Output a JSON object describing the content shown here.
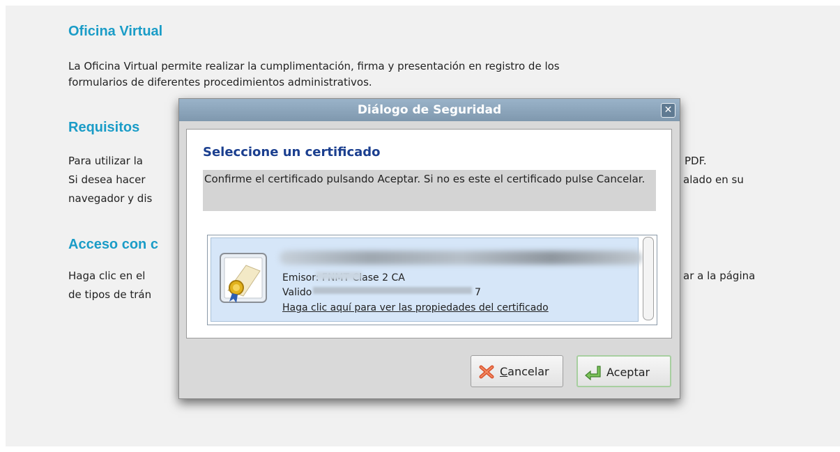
{
  "page": {
    "heading1": "Oficina Virtual",
    "para1_line1": "La Oficina Virtual permite realizar la cumplimentación, firma y presentación en registro de los",
    "para1_line2": "formularios de diferentes procedimientos administrativos.",
    "heading2": "Requisitos",
    "para2_line1_left": "Para utilizar la",
    "para2_line1_right": "PDF.",
    "para2_line2_left": "Si desea hacer",
    "para2_line2_right": "alado en su",
    "para2_line3_left": "navegador y dis",
    "heading3": "Acceso con c",
    "para3_line1_left": "Haga clic en el",
    "para3_line1_right": "ar a la página",
    "para3_line2_left": "de tipos de trán"
  },
  "dialog": {
    "title": "Diálogo de Seguridad",
    "close_glyph": "✕",
    "select_title": "Seleccione un certificado",
    "message": "Confirme el certificado pulsando Aceptar. Si no es este el certificado pulse Cancelar.",
    "cert": {
      "emisor": "Emisor: FNMT Clase 2 CA",
      "valido": "Valido",
      "valido_tail": "7",
      "link": "Haga clic aquí para ver las propiedades del certificado"
    },
    "cancel_underlined": "C",
    "cancel_rest": "ancelar",
    "accept": "Aceptar"
  },
  "colors": {
    "heading": "#1a9cc7",
    "title_bar": "#8ca5bc",
    "select_title": "#1b3f8f"
  }
}
